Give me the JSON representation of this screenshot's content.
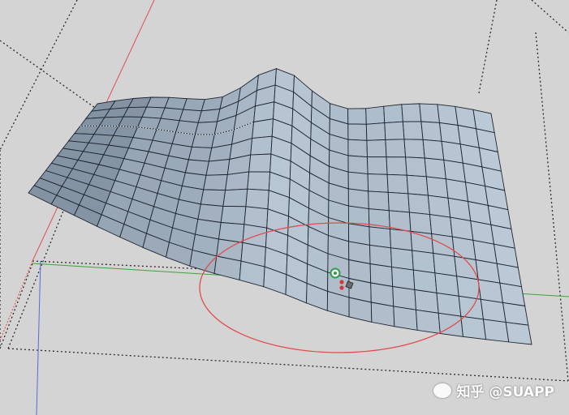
{
  "viewport": {
    "background": "#d4d4d4",
    "axes": {
      "red": "#e05050",
      "green": "#3aa43a",
      "blue": "#5a6ad8"
    },
    "mesh": {
      "fill_light": "#c5d3e0",
      "fill_dark": "#7d8c9c",
      "grid_line": "#1e2530",
      "columns": 22,
      "rows": 12
    },
    "brush_ring_color": "#e24b4b",
    "cursor_color": "#2e9e4a"
  },
  "watermark": {
    "text": "知乎 @SUAPP"
  }
}
